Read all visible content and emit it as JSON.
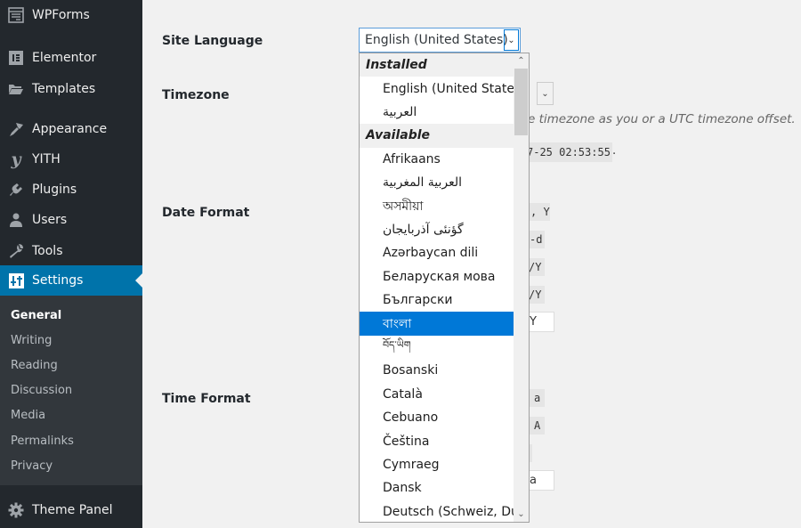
{
  "sidebar": {
    "items": [
      {
        "label": "WPForms",
        "icon": "wpforms-icon"
      },
      {
        "label": "Elementor",
        "icon": "elementor-icon"
      },
      {
        "label": "Templates",
        "icon": "folder-icon"
      },
      {
        "label": "Appearance",
        "icon": "paintbrush-icon"
      },
      {
        "label": "YITH",
        "icon": "yith-icon"
      },
      {
        "label": "Plugins",
        "icon": "plugin-icon"
      },
      {
        "label": "Users",
        "icon": "user-icon"
      },
      {
        "label": "Tools",
        "icon": "wrench-icon"
      },
      {
        "label": "Settings",
        "icon": "settings-icon",
        "active": true
      },
      {
        "label": "Theme Panel",
        "icon": "gear-icon"
      }
    ],
    "submenu": [
      {
        "label": "General",
        "current": true
      },
      {
        "label": "Writing"
      },
      {
        "label": "Reading"
      },
      {
        "label": "Discussion"
      },
      {
        "label": "Media"
      },
      {
        "label": "Permalinks"
      },
      {
        "label": "Privacy"
      }
    ]
  },
  "fields": {
    "site_language": {
      "label": "Site Language",
      "value": "English (United States)"
    },
    "timezone": {
      "label": "Timezone",
      "description_fragment": "e timezone as you or a UTC timezone offset.",
      "time_fragment": "7-25 02:53:55",
      "time_suffix": "."
    },
    "date_format": {
      "label": "Date Format",
      "options_fragments": [
        ", Y",
        "-d",
        "/Y",
        "/Y"
      ],
      "custom_fragment": "Y"
    },
    "time_format": {
      "label": "Time Format",
      "options_fragments": [
        "a",
        "A",
        ""
      ],
      "custom_fragment": "a"
    }
  },
  "language_dropdown": {
    "groups": {
      "installed": "Installed",
      "available": "Available"
    },
    "installed_options": [
      "English (United States)",
      "العربية"
    ],
    "available_options": [
      "Afrikaans",
      "العربية المغربية",
      "অসমীয়া",
      "گؤنئی آذربایجان",
      "Azərbaycan dili",
      "Беларуская мова",
      "Български",
      "বাংলা",
      "བོད་ཡིག",
      "Bosanski",
      "Català",
      "Cebuano",
      "Čeština",
      "Cymraeg",
      "Dansk",
      "Deutsch (Schweiz, Du)"
    ],
    "highlighted": "বাংলা",
    "scroll_up": "⌃",
    "scroll_down": "⌄"
  },
  "colors": {
    "sidebar_bg": "#23282d",
    "submenu_bg": "#32373c",
    "accent": "#0073aa",
    "selection": "#0078d7"
  }
}
